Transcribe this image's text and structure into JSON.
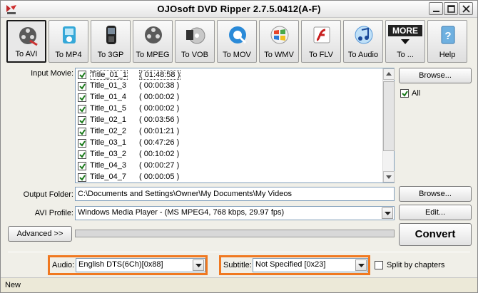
{
  "window": {
    "title": "OJOsoft DVD Ripper 2.7.5.0412(A-F)"
  },
  "toolbar": [
    {
      "label": "To AVI",
      "icon": "film-reel-icon",
      "active": true
    },
    {
      "label": "To MP4",
      "icon": "mp4-player-icon"
    },
    {
      "label": "To 3GP",
      "icon": "mobile-phone-icon"
    },
    {
      "label": "To MPEG",
      "icon": "film-reel-icon"
    },
    {
      "label": "To VOB",
      "icon": "dvd-film-icon"
    },
    {
      "label": "To MOV",
      "icon": "quicktime-icon"
    },
    {
      "label": "To WMV",
      "icon": "windows-media-icon"
    },
    {
      "label": "To FLV",
      "icon": "flash-icon"
    },
    {
      "label": "To Audio",
      "icon": "music-note-icon"
    },
    {
      "label": "To ...",
      "icon": "more-icon",
      "badge": "MORE"
    },
    {
      "label": "Help",
      "icon": "help-book-icon"
    }
  ],
  "input": {
    "label": "Input Movie:",
    "titles": [
      {
        "name": "Title_01_1",
        "time": "( 01:48:58 )",
        "checked": true,
        "selected": true
      },
      {
        "name": "Title_01_3",
        "time": "( 00:00:38 )",
        "checked": true
      },
      {
        "name": "Title_01_4",
        "time": "( 00:00:02 )",
        "checked": true
      },
      {
        "name": "Title_01_5",
        "time": "( 00:00:02 )",
        "checked": true
      },
      {
        "name": "Title_02_1",
        "time": "( 00:03:56 )",
        "checked": true
      },
      {
        "name": "Title_02_2",
        "time": "( 00:01:21 )",
        "checked": true
      },
      {
        "name": "Title_03_1",
        "time": "( 00:47:26 )",
        "checked": true
      },
      {
        "name": "Title_03_2",
        "time": "( 00:10:02 )",
        "checked": true
      },
      {
        "name": "Title_04_3",
        "time": "( 00:00:27 )",
        "checked": true
      },
      {
        "name": "Title_04_7",
        "time": "( 00:00:05 )",
        "checked": true
      }
    ],
    "browse_label": "Browse...",
    "all_label": "All",
    "all_checked": true
  },
  "output": {
    "label": "Output Folder:",
    "value": "C:\\Documents and Settings\\Owner\\My Documents\\My Videos",
    "browse_label": "Browse..."
  },
  "profile": {
    "label": "AVI Profile:",
    "value": "Windows Media Player - (MS MPEG4, 768 kbps, 29.97 fps)",
    "edit_label": "Edit..."
  },
  "advanced_label": "Advanced >>",
  "convert_label": "Convert",
  "audio": {
    "label": "Audio:",
    "value": "English DTS(6Ch)[0x88]"
  },
  "subtitle": {
    "label": "Subtitle:",
    "value": "Not Specified [0x23]"
  },
  "split": {
    "label": "Split by chapters",
    "checked": false
  },
  "status": {
    "text": "New"
  },
  "colors": {
    "highlight": "#f07820",
    "list_border": "#7f9db9"
  }
}
